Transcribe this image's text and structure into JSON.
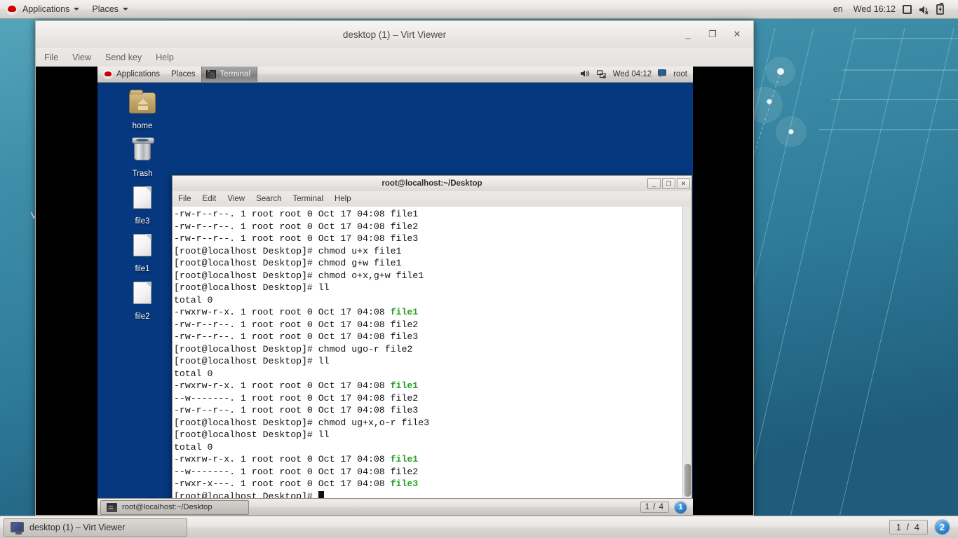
{
  "host_panel": {
    "logo_name": "redhat-logo",
    "applications_label": "Applications",
    "places_label": "Places",
    "language": "en",
    "clock": "Wed 16:12"
  },
  "virt_window": {
    "title": "desktop (1) – Virt Viewer",
    "menu": [
      "File",
      "View",
      "Send key",
      "Help"
    ],
    "minimize": "_",
    "maximize": "❐",
    "close": "✕"
  },
  "guest_panel": {
    "applications_label": "Applications",
    "places_label": "Places",
    "active_window": "Terminal",
    "clock": "Wed 04:12",
    "user": "root"
  },
  "desktop_icons": [
    {
      "label": "home",
      "icon": "home-folder-icon"
    },
    {
      "label": "Trash",
      "icon": "trash-icon"
    },
    {
      "label": "file3",
      "icon": "file-icon"
    },
    {
      "label": "file1",
      "icon": "file-icon"
    },
    {
      "label": "file2",
      "icon": "file-icon"
    }
  ],
  "terminal": {
    "title": "root@localhost:~/Desktop",
    "menu": [
      "File",
      "Edit",
      "View",
      "Search",
      "Terminal",
      "Help"
    ],
    "minimize": "_",
    "maximize": "❐",
    "close": "✕",
    "prompt": "[root@localhost Desktop]# ",
    "lines": [
      {
        "text": "-rw-r--r--. 1 root root 0 Oct 17 04:08 file1"
      },
      {
        "text": "-rw-r--r--. 1 root root 0 Oct 17 04:08 file2"
      },
      {
        "text": "-rw-r--r--. 1 root root 0 Oct 17 04:08 file3"
      },
      {
        "text": "[root@localhost Desktop]# chmod u+x file1"
      },
      {
        "text": "[root@localhost Desktop]# chmod g+w file1"
      },
      {
        "text": "[root@localhost Desktop]# chmod o+x,g+w file1"
      },
      {
        "text": "[root@localhost Desktop]# ll"
      },
      {
        "text": "total 0"
      },
      {
        "text": "-rwxrw-r-x. 1 root root 0 Oct 17 04:08 ",
        "green": "file1"
      },
      {
        "text": "-rw-r--r--. 1 root root 0 Oct 17 04:08 file2"
      },
      {
        "text": "-rw-r--r--. 1 root root 0 Oct 17 04:08 file3"
      },
      {
        "text": "[root@localhost Desktop]# chmod ugo-r file2"
      },
      {
        "text": "[root@localhost Desktop]# ll"
      },
      {
        "text": "total 0"
      },
      {
        "text": "-rwxrw-r-x. 1 root root 0 Oct 17 04:08 ",
        "green": "file1"
      },
      {
        "text": "--w-------. 1 root root 0 Oct 17 04:08 file2"
      },
      {
        "text": "-rw-r--r--. 1 root root 0 Oct 17 04:08 file3"
      },
      {
        "text": "[root@localhost Desktop]# chmod ug+x,o-r file3"
      },
      {
        "text": "[root@localhost Desktop]# ll"
      },
      {
        "text": "total 0"
      },
      {
        "text": "-rwxrw-r-x. 1 root root 0 Oct 17 04:08 ",
        "green": "file1"
      },
      {
        "text": "--w-------. 1 root root 0 Oct 17 04:08 file2"
      },
      {
        "text": "-rwxr-x---. 1 root root 0 Oct 17 04:08 ",
        "green": "file3"
      },
      {
        "text": "[root@localhost Desktop]# ",
        "cursor": true
      }
    ]
  },
  "guest_taskbar": {
    "task_label": "root@localhost:~/Desktop",
    "workspace_count": "1 / 4",
    "workspace_current": "1"
  },
  "host_taskbar": {
    "task_label": "desktop (1) – Virt Viewer",
    "workspace_count": "1 / 4",
    "workspace_current": "2"
  },
  "misc": {
    "edge_text": "V"
  },
  "colors": {
    "guest_desktop_blue": "#05387e",
    "terminal_green": "#26a226",
    "host_wallpaper_teal": "#3d8ca8",
    "redhat_red": "#cc0000"
  }
}
